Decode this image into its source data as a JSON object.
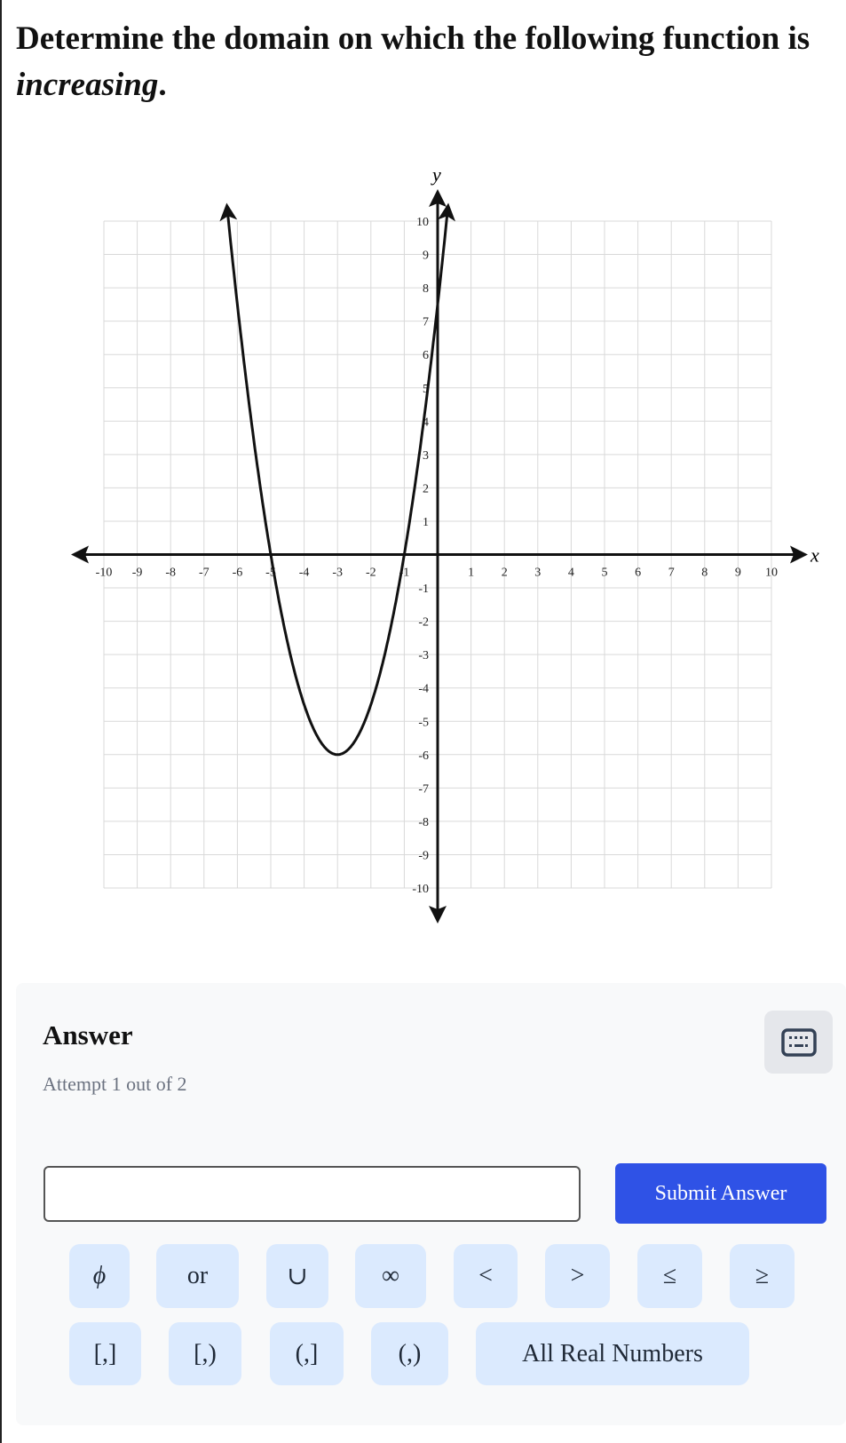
{
  "question": {
    "text_before": "Determine the domain on which the following function is ",
    "emphasis": "increasing",
    "text_after": "."
  },
  "chart_data": {
    "type": "line",
    "xlabel": "x",
    "ylabel": "y",
    "xlim": [
      -10,
      10
    ],
    "ylim": [
      -10,
      10
    ],
    "grid": true,
    "x_ticks": [
      -10,
      -9,
      -8,
      -7,
      -6,
      -5,
      -4,
      -3,
      -2,
      -1,
      1,
      2,
      3,
      4,
      5,
      6,
      7,
      8,
      9,
      10
    ],
    "y_ticks": [
      -10,
      -9,
      -8,
      -7,
      -6,
      -5,
      -4,
      -3,
      -2,
      -1,
      1,
      2,
      3,
      4,
      5,
      6,
      7,
      8,
      9,
      10
    ],
    "series": [
      {
        "equation": "y = 1.5(x+3)^2 - 6",
        "vertex": [
          -3,
          -6
        ],
        "x_intercepts": [
          -5,
          -1
        ],
        "y_intercept": 7.5,
        "x_range": [
          -6.3,
          0.3
        ],
        "color": "#111111"
      }
    ]
  },
  "answer": {
    "heading": "Answer",
    "attempt": "Attempt 1 out of 2",
    "input_value": "",
    "submit_label": "Submit Answer",
    "keyboard_icon": "keyboard-icon",
    "symbol_keys": [
      "ϕ",
      "or",
      "∪",
      "∞",
      "<",
      ">",
      "≤",
      "≥"
    ],
    "interval_keys": [
      "[,]",
      "[,)",
      "(,]",
      "(,)",
      "All Real Numbers"
    ]
  },
  "colors": {
    "accent": "#2f52e6",
    "key_bg": "#dbeafe",
    "panel_bg": "#f8f9fa"
  }
}
